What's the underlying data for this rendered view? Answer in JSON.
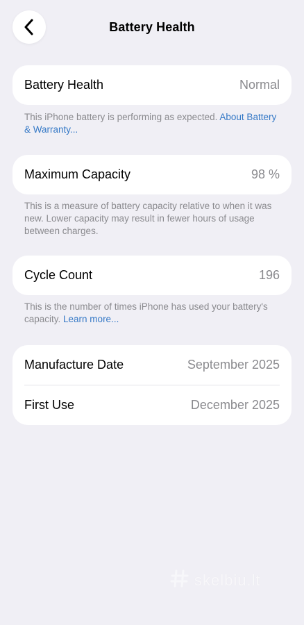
{
  "header": {
    "title": "Battery Health",
    "back_icon": "chevron-left-icon"
  },
  "health": {
    "label": "Battery Health",
    "value": "Normal",
    "note_text": "This iPhone battery is performing as expected. ",
    "note_link": "About Battery & Warranty..."
  },
  "capacity": {
    "label": "Maximum Capacity",
    "value": "98 %",
    "note_text": "This is a measure of battery capacity relative to when it was new. Lower capacity may result in fewer hours of usage between charges."
  },
  "cycles": {
    "label": "Cycle Count",
    "value": "196",
    "note_text": "This is the number of times iPhone has used your battery's capacity. ",
    "note_link": "Learn more..."
  },
  "dates": {
    "manufacture_label": "Manufacture Date",
    "manufacture_value": "September 2025",
    "first_use_label": "First Use",
    "first_use_value": "December 2025"
  },
  "watermark": {
    "text": "skelbiu.lt"
  },
  "colors": {
    "background": "#f0eff5",
    "card": "#ffffff",
    "secondary_text": "#8a8a8e",
    "link": "#3478c6"
  }
}
